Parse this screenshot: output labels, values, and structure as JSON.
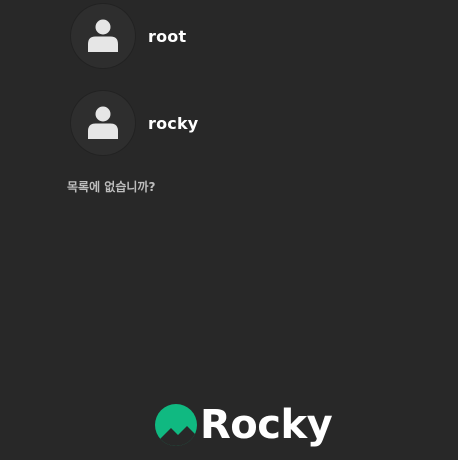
{
  "users": [
    {
      "name": "root",
      "icon": "user-icon"
    },
    {
      "name": "rocky",
      "icon": "user-icon"
    }
  ],
  "not_listed_label": "목록에 없습니까?",
  "branding": {
    "logo_text": "Rocky",
    "logo_icon": "rocky-mountain-icon",
    "accent_color": "#10b981"
  }
}
